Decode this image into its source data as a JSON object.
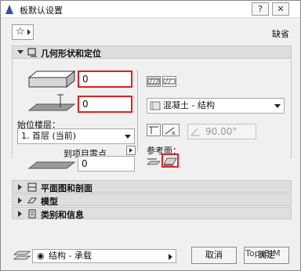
{
  "window": {
    "title": "板默认设置",
    "help_label": "?",
    "close_label": "✕"
  },
  "toolbar": {
    "right_label": "缺省"
  },
  "geometry": {
    "section_label": "几何形状和定位",
    "thickness_value": "0",
    "offset_value": "0",
    "home_story_label": "始位楼层：",
    "home_story_value": "1. 首层 (当前)",
    "to_project_zero_label": "到项目零点",
    "project_zero_value": "0",
    "material_value": "混凝土 - 结构",
    "angle_value": "90.00°",
    "reference_plane_label": "参考面："
  },
  "sections": [
    {
      "label": "平面图和剖面"
    },
    {
      "label": "模型"
    },
    {
      "label": "类别和信息"
    }
  ],
  "footer": {
    "layer_value": "结构 - 承载",
    "cancel_label": "取消",
    "ok_label": "确定",
    "watermark": "TopsBIM"
  },
  "colors": {
    "highlight": "#e02020"
  }
}
